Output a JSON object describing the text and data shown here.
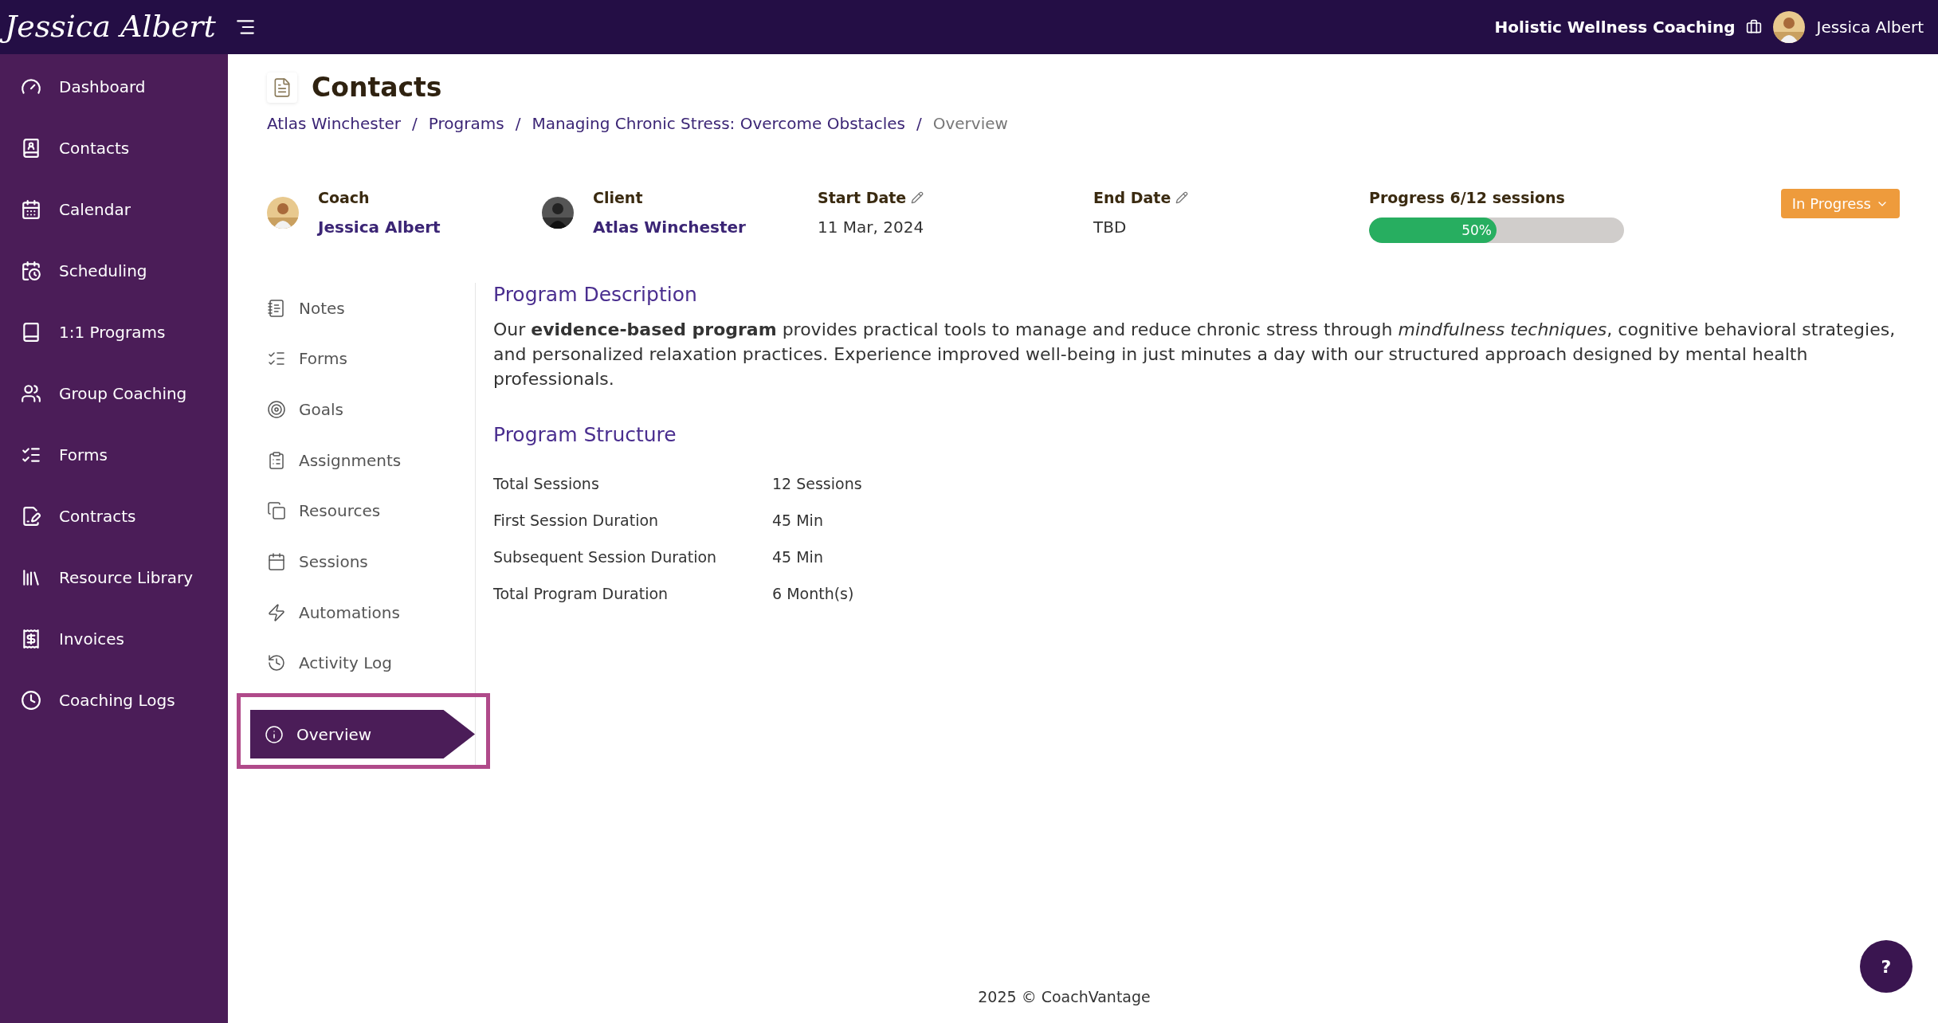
{
  "topbar": {
    "logo": "Jessica Albert",
    "business": "Holistic Wellness Coaching",
    "user": "Jessica Albert"
  },
  "sidebar": {
    "items": [
      {
        "label": "Dashboard"
      },
      {
        "label": "Contacts"
      },
      {
        "label": "Calendar"
      },
      {
        "label": "Scheduling"
      },
      {
        "label": "1:1 Programs"
      },
      {
        "label": "Group Coaching"
      },
      {
        "label": "Forms"
      },
      {
        "label": "Contracts"
      },
      {
        "label": "Resource Library"
      },
      {
        "label": "Invoices"
      },
      {
        "label": "Coaching Logs"
      }
    ]
  },
  "page": {
    "title": "Contacts",
    "separator": "/",
    "breadcrumb": [
      {
        "label": "Atlas Winchester",
        "kind": "link"
      },
      {
        "label": "Programs",
        "kind": "link"
      },
      {
        "label": "Managing Chronic Stress: Overcome Obstacles",
        "kind": "link"
      },
      {
        "label": "Overview",
        "kind": "current"
      }
    ]
  },
  "info": {
    "coach": {
      "label": "Coach",
      "name": "Jessica Albert"
    },
    "client": {
      "label": "Client",
      "name": "Atlas Winchester"
    },
    "start_date": {
      "label": "Start Date",
      "value": "11 Mar, 2024"
    },
    "end_date": {
      "label": "End Date",
      "value": "TBD"
    },
    "progress": {
      "label": "Progress 6/12 sessions",
      "level": 0.5,
      "reading": "50%"
    },
    "status": "In Progress"
  },
  "subnav": [
    {
      "label": "Notes",
      "selected": false
    },
    {
      "label": "Forms",
      "selected": false
    },
    {
      "label": "Goals",
      "selected": false
    },
    {
      "label": "Assignments",
      "selected": false
    },
    {
      "label": "Resources",
      "selected": false
    },
    {
      "label": "Sessions",
      "selected": false
    },
    {
      "label": "Automations",
      "selected": false
    },
    {
      "label": "Activity Log",
      "selected": false
    },
    {
      "label": "Overview",
      "selected": true
    }
  ],
  "description": {
    "heading": "Program Description",
    "text": "Our **evidence-based program** provides practical tools to manage and reduce chronic stress through *mindfulness techniques*, cognitive behavioral strategies, and personalized relaxation practices. Experience improved well-being in just minutes a day with our structured approach designed by mental health professionals."
  },
  "structure": {
    "heading": "Program Structure",
    "rows": [
      {
        "label": "Total Sessions",
        "value": "12 Sessions"
      },
      {
        "label": "First Session Duration",
        "value": "45 Min"
      },
      {
        "label": "Subsequent Session Duration",
        "value": "45 Min"
      },
      {
        "label": "Total Program Duration",
        "value": "6 Month(s)"
      }
    ]
  },
  "footer": "2025 © CoachVantage",
  "help": "?"
}
